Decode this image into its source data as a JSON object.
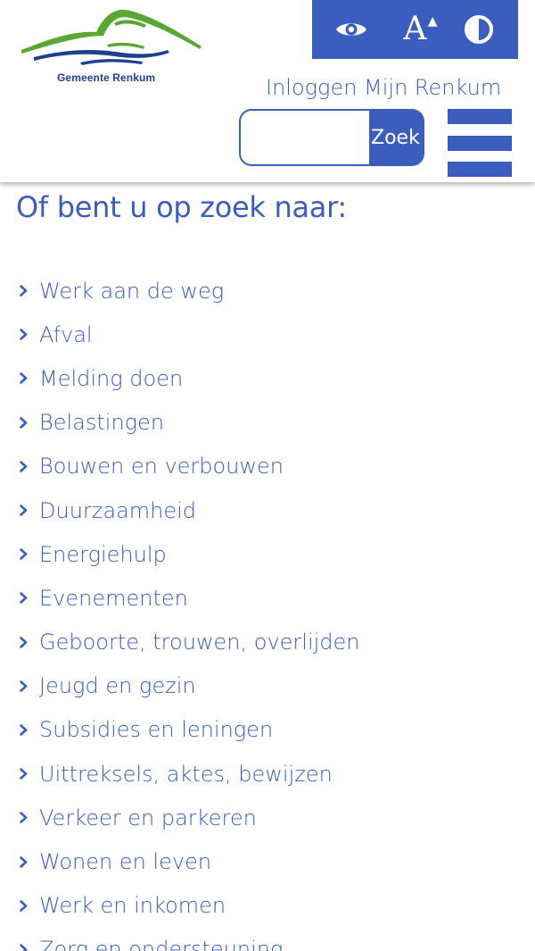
{
  "header": {
    "logo_text": "Gemeente Renkum",
    "accessibility": {
      "read_aloud_icon": "eye-icon",
      "font_size_label": "A",
      "font_size_icon": "font-size-increase-icon",
      "contrast_icon": "contrast-icon"
    },
    "login_link": "Inloggen Mijn Renkum",
    "search": {
      "placeholder": "",
      "value": "",
      "button_label": "Zoek"
    },
    "menu_icon": "hamburger-menu-icon"
  },
  "main": {
    "title": "Of bent u op zoek naar:",
    "topics": [
      "Werk aan de weg",
      "Afval",
      "Melding doen",
      "Belastingen",
      "Bouwen en verbouwen",
      "Duurzaamheid",
      "Energiehulp",
      "Evenementen",
      "Geboorte, trouwen, overlijden",
      "Jeugd en gezin",
      "Subsidies en leningen",
      "Uittreksels, aktes, bewijzen",
      "Verkeer en parkeren",
      "Wonen en leven",
      "Werk en inkomen",
      "Zorg en ondersteuning"
    ]
  },
  "colors": {
    "brand_blue": "#3a5dbe",
    "logo_green": "#5aa832",
    "logo_navy": "#1f3f8f"
  }
}
